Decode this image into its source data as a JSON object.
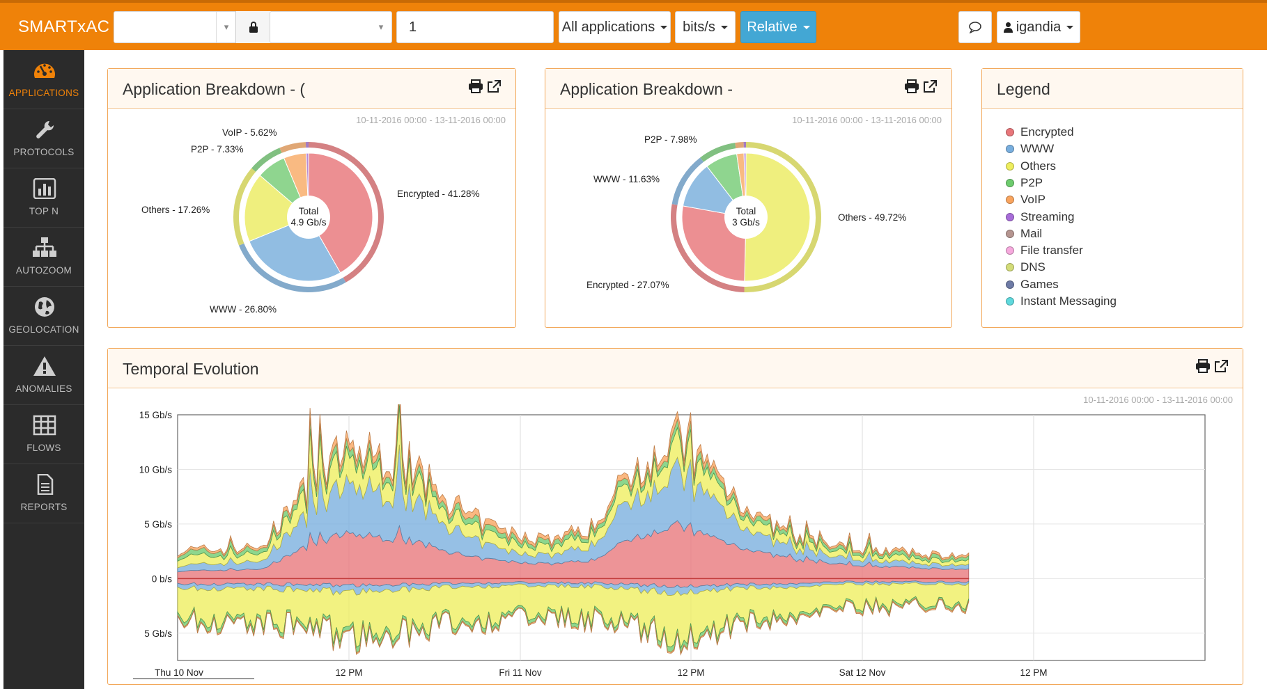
{
  "app": {
    "brand": "SMARTxAC"
  },
  "toolbar": {
    "filter_value": "1",
    "applications_label": "All applications",
    "units_label": "bits/s",
    "mode_label": "Relative",
    "user_label": "igandia"
  },
  "sidebar": {
    "items": [
      {
        "label": "APPLICATIONS",
        "icon": "dashboard-icon"
      },
      {
        "label": "PROTOCOLS",
        "icon": "wrench-icon"
      },
      {
        "label": "TOP N",
        "icon": "bar-chart-icon"
      },
      {
        "label": "AUTOZOOM",
        "icon": "sitemap-icon"
      },
      {
        "label": "GEOLOCATION",
        "icon": "globe-icon"
      },
      {
        "label": "ANOMALIES",
        "icon": "warning-icon"
      },
      {
        "label": "FLOWS",
        "icon": "table-icon"
      },
      {
        "label": "REPORTS",
        "icon": "file-icon"
      }
    ]
  },
  "breakdown1": {
    "title": "Application Breakdown - (",
    "date_range": "10-11-2016 00:00 - 13-11-2016 00:00",
    "center_label": "Total",
    "center_value": "4.9 Gb/s",
    "labels": {
      "voip": "VoIP - 5.62%",
      "p2p": "P2P - 7.33%",
      "others": "Others - 17.26%",
      "encrypted": "Encrypted - 41.28%",
      "www": "WWW - 26.80%"
    }
  },
  "breakdown2": {
    "title": "Application Breakdown -",
    "date_range": "10-11-2016 00:00 - 13-11-2016 00:00",
    "center_label": "Total",
    "center_value": "3 Gb/s",
    "labels": {
      "p2p": "P2P - 7.98%",
      "www": "WWW - 11.63%",
      "others": "Others - 49.72%",
      "encrypted": "Encrypted - 27.07%"
    }
  },
  "legend": {
    "title": "Legend",
    "items": [
      {
        "label": "Encrypted",
        "color": "#e8767a"
      },
      {
        "label": "WWW",
        "color": "#78aede"
      },
      {
        "label": "Others",
        "color": "#eeee5e"
      },
      {
        "label": "P2P",
        "color": "#6dcb6d"
      },
      {
        "label": "VoIP",
        "color": "#f9a45e"
      },
      {
        "label": "Streaming",
        "color": "#a76cd8"
      },
      {
        "label": "Mail",
        "color": "#b59590"
      },
      {
        "label": "File transfer",
        "color": "#f6a9dd"
      },
      {
        "label": "DNS",
        "color": "#d3dc78"
      },
      {
        "label": "Games",
        "color": "#6e7ba6"
      },
      {
        "label": "Instant Messaging",
        "color": "#5fd9dd"
      }
    ]
  },
  "temporal": {
    "title": "Temporal Evolution",
    "date_range": "10-11-2016 00:00 - 13-11-2016 00:00",
    "y_ticks": [
      "15 Gb/s",
      "10 Gb/s",
      "5 Gb/s",
      "0 b/s",
      "5 Gb/s"
    ],
    "x_ticks": [
      "Thu 10 Nov",
      "12 PM",
      "Fri 11 Nov",
      "12 PM",
      "Sat 12 Nov",
      "12 PM"
    ]
  },
  "chart_data": [
    {
      "type": "pie",
      "center_text": [
        "Total",
        "4.9 Gb/s"
      ],
      "labels": [
        "Encrypted",
        "WWW",
        "Others",
        "P2P",
        "VoIP",
        "Streaming"
      ],
      "values": [
        41.28,
        26.8,
        17.26,
        7.33,
        5.62,
        0.6
      ],
      "colors": [
        "#ec8f92",
        "#91bde2",
        "#efef7e",
        "#8fd58f",
        "#f9ba82",
        "#b58ad8"
      ]
    },
    {
      "type": "pie",
      "center_text": [
        "Total",
        "3 Gb/s"
      ],
      "labels": [
        "Others",
        "Encrypted",
        "WWW",
        "P2P",
        "VoIP",
        "Streaming"
      ],
      "values": [
        49.72,
        27.07,
        11.63,
        7.98,
        1.8,
        0.5
      ],
      "colors": [
        "#efef7e",
        "#ec8f92",
        "#91bde2",
        "#8fd58f",
        "#f9ba82",
        "#b58ad8"
      ]
    },
    {
      "type": "area",
      "x_labels": [
        "Thu 10 Nov",
        "12 PM",
        "Fri 11 Nov",
        "12 PM",
        "Sat 12 Nov",
        "12 PM"
      ],
      "yunit": "Gb/s",
      "ylim": [
        -7.5,
        15
      ],
      "series": [
        {
          "name": "Encrypted",
          "color": "#e8767a",
          "upper": [
            0.8,
            0.9,
            1.0,
            3.2,
            4.8,
            4.4,
            3.6,
            2.3,
            1.8,
            1.6,
            2.0,
            4.6,
            5.7,
            4.2,
            2.8,
            1.9,
            1.5,
            1.3,
            1.1,
            1.0
          ],
          "lower": [
            0.5,
            0.5,
            0.5,
            0.6,
            0.6,
            0.6,
            0.5,
            0.4,
            0.4,
            0.4,
            0.4,
            0.6,
            0.7,
            0.6,
            0.5,
            0.4,
            0.3,
            0.3,
            0.3,
            0.3
          ]
        },
        {
          "name": "WWW",
          "color": "#78aede",
          "upper": [
            0.5,
            0.6,
            0.7,
            2.6,
            4.3,
            4.2,
            3.2,
            1.6,
            0.9,
            0.8,
            1.4,
            3.9,
            4.7,
            3.2,
            1.5,
            0.8,
            0.6,
            0.5,
            0.4,
            0.4
          ],
          "lower": [
            0.4,
            0.4,
            0.4,
            0.5,
            0.6,
            0.5,
            0.4,
            0.3,
            0.3,
            0.3,
            0.3,
            0.5,
            0.6,
            0.4,
            0.3,
            0.3,
            0.2,
            0.2,
            0.2,
            0.2
          ]
        },
        {
          "name": "Others",
          "color": "#eeee5e",
          "upper": [
            0.8,
            0.7,
            0.7,
            1.7,
            2.2,
            2.0,
            1.6,
            1.1,
            0.9,
            0.8,
            1.0,
            1.6,
            2.2,
            1.6,
            0.9,
            0.6,
            0.5,
            0.5,
            0.4,
            0.4
          ],
          "lower": [
            2.6,
            2.8,
            2.9,
            3.1,
            3.6,
            3.9,
            3.3,
            3.0,
            2.8,
            2.7,
            2.8,
            3.2,
            4.0,
            3.4,
            2.6,
            2.2,
            2.0,
            1.9,
            1.8,
            1.7
          ]
        },
        {
          "name": "P2P",
          "color": "#6dcb6d",
          "upper": [
            0.4,
            0.4,
            0.4,
            0.5,
            0.6,
            0.6,
            0.5,
            0.5,
            0.4,
            0.4,
            0.4,
            0.5,
            0.6,
            0.5,
            0.4,
            0.3,
            0.3,
            0.3,
            0.3,
            0.3
          ],
          "lower": [
            0.3,
            0.3,
            0.3,
            0.3,
            0.4,
            0.4,
            0.3,
            0.3,
            0.3,
            0.3,
            0.3,
            0.3,
            0.4,
            0.3,
            0.3,
            0.2,
            0.2,
            0.2,
            0.2,
            0.2
          ]
        },
        {
          "name": "VoIP",
          "color": "#f9a45e",
          "upper": [
            0.2,
            0.2,
            0.2,
            0.4,
            0.6,
            0.6,
            0.6,
            0.5,
            0.4,
            0.3,
            0.3,
            0.5,
            0.6,
            0.5,
            0.3,
            0.2,
            0.2,
            0.2,
            0.2,
            0.2
          ],
          "lower": [
            0.1,
            0.1,
            0.1,
            0.1,
            0.1,
            0.1,
            0.1,
            0.1,
            0.1,
            0.1,
            0.1,
            0.1,
            0.1,
            0.1,
            0.1,
            0.1,
            0.1,
            0.1,
            0.1,
            0.1
          ]
        }
      ]
    }
  ]
}
